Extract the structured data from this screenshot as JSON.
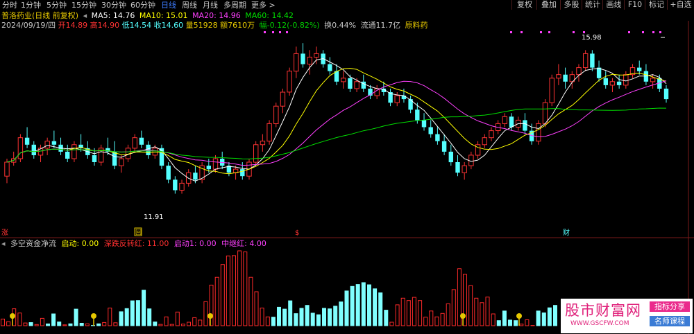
{
  "periods": [
    "分时",
    "1分钟",
    "5分钟",
    "15分钟",
    "30分钟",
    "60分钟",
    "日线",
    "周线",
    "月线",
    "多周期",
    "更多 >"
  ],
  "active_period": "日线",
  "right_buttons": [
    "复权",
    "叠加",
    "多股",
    "统计",
    "画线",
    "F10",
    "标记",
    "+自选"
  ],
  "stock": {
    "title": "普洛药业(日线 前复权)"
  },
  "ma": [
    {
      "label": "MA5: 14.76",
      "color": "#ffffff"
    },
    {
      "label": "MA10: 15.01",
      "color": "#ffff00"
    },
    {
      "label": "MA20: 14.96",
      "color": "#ff40ff"
    },
    {
      "label": "MA60: 14.42",
      "color": "#00e000"
    }
  ],
  "quote": {
    "date": "2024/09/19/四",
    "open": "开14.89",
    "high": "高14.90",
    "low": "低14.54",
    "close": "收14.60",
    "volume": "量51928",
    "amount": "额7610万",
    "change": "幅-0.12(-0.82%)",
    "turnover": "换0.44%",
    "float": "流通11.7亿",
    "concept": "原料药"
  },
  "annotations": {
    "high_label": "15.98",
    "low_label": "11.91"
  },
  "markers": {
    "zhang": "涨",
    "hui": "回",
    "dollar": "$",
    "cai": "财"
  },
  "indicator": {
    "name": "多空资金净流",
    "params": [
      {
        "text": "启动: 0.00",
        "color": "#ffff00"
      },
      {
        "text": "深跌反转红: 11.00",
        "color": "#ff3030"
      },
      {
        "text": "启动1: 0.00",
        "color": "#ff40ff"
      },
      {
        "text": "中继红: 4.00",
        "color": "#ff40ff"
      }
    ]
  },
  "watermark": {
    "title": "股市财富网",
    "url": "WWW.GSCFW.COM",
    "badge1": "指标分享",
    "badge2": "名师课程"
  },
  "colors": {
    "up": "#ff3333",
    "down": "#54ffff",
    "ma5": "#ffffff",
    "ma10": "#ffff00",
    "ma20": "#ff40ff",
    "ma60": "#00e000",
    "grid": "#7a1a1a"
  },
  "chart_data": {
    "type": "candlestick",
    "ylim": [
      11.0,
      16.6
    ],
    "candles": [
      [
        12.4,
        12.9,
        12.2,
        12.8
      ],
      [
        12.8,
        13.1,
        12.7,
        12.9
      ],
      [
        12.9,
        13.6,
        12.8,
        13.5
      ],
      [
        13.5,
        13.8,
        13.2,
        13.3
      ],
      [
        13.3,
        13.4,
        12.9,
        13.0
      ],
      [
        13.0,
        13.3,
        12.8,
        13.2
      ],
      [
        13.2,
        13.5,
        13.0,
        13.4
      ],
      [
        13.4,
        13.7,
        13.2,
        13.3
      ],
      [
        13.3,
        13.5,
        13.0,
        13.1
      ],
      [
        13.1,
        13.3,
        12.8,
        12.9
      ],
      [
        12.9,
        13.4,
        12.8,
        13.3
      ],
      [
        13.3,
        13.6,
        13.1,
        13.2
      ],
      [
        13.2,
        13.4,
        12.9,
        13.0
      ],
      [
        13.0,
        13.2,
        12.7,
        12.8
      ],
      [
        12.8,
        13.3,
        12.7,
        13.2
      ],
      [
        13.2,
        13.5,
        13.0,
        13.1
      ],
      [
        13.1,
        13.4,
        12.6,
        12.7
      ],
      [
        12.7,
        13.0,
        12.5,
        12.9
      ],
      [
        12.9,
        13.3,
        12.8,
        13.2
      ],
      [
        13.2,
        13.6,
        13.1,
        13.5
      ],
      [
        13.5,
        13.7,
        13.2,
        13.3
      ],
      [
        13.3,
        13.4,
        12.9,
        13.0
      ],
      [
        13.0,
        13.3,
        12.9,
        13.2
      ],
      [
        13.2,
        13.3,
        12.6,
        12.7
      ],
      [
        12.7,
        12.8,
        12.2,
        12.3
      ],
      [
        12.3,
        12.4,
        11.9,
        12.0
      ],
      [
        12.0,
        12.3,
        11.9,
        12.2
      ],
      [
        12.2,
        12.6,
        12.1,
        12.5
      ],
      [
        12.5,
        12.7,
        12.2,
        12.3
      ],
      [
        12.3,
        12.8,
        12.2,
        12.7
      ],
      [
        12.7,
        12.9,
        12.5,
        12.6
      ],
      [
        12.6,
        13.0,
        12.5,
        12.9
      ],
      [
        12.9,
        13.1,
        12.6,
        12.7
      ],
      [
        12.7,
        12.8,
        12.4,
        12.5
      ],
      [
        12.5,
        12.7,
        12.3,
        12.6
      ],
      [
        12.6,
        12.8,
        12.3,
        12.4
      ],
      [
        12.4,
        12.9,
        12.3,
        12.8
      ],
      [
        12.8,
        13.4,
        12.7,
        13.3
      ],
      [
        13.3,
        13.6,
        13.1,
        13.4
      ],
      [
        13.4,
        14.0,
        13.3,
        13.9
      ],
      [
        13.9,
        14.5,
        13.8,
        14.4
      ],
      [
        14.4,
        14.9,
        14.2,
        14.8
      ],
      [
        14.8,
        15.5,
        14.7,
        15.4
      ],
      [
        15.4,
        16.1,
        15.2,
        15.9
      ],
      [
        15.9,
        16.2,
        15.5,
        15.6
      ],
      [
        15.6,
        16.0,
        15.3,
        15.8
      ],
      [
        15.8,
        16.1,
        15.6,
        15.9
      ],
      [
        15.9,
        16.0,
        15.5,
        15.6
      ],
      [
        15.6,
        15.8,
        15.3,
        15.4
      ],
      [
        15.4,
        15.6,
        15.0,
        15.1
      ],
      [
        15.1,
        15.4,
        14.9,
        15.2
      ],
      [
        15.2,
        15.3,
        14.8,
        14.9
      ],
      [
        14.9,
        15.2,
        14.8,
        15.1
      ],
      [
        15.1,
        15.3,
        14.8,
        14.9
      ],
      [
        14.9,
        15.0,
        14.6,
        14.7
      ],
      [
        14.7,
        15.0,
        14.6,
        14.9
      ],
      [
        14.9,
        15.1,
        14.7,
        14.8
      ],
      [
        14.8,
        14.9,
        14.4,
        14.5
      ],
      [
        14.5,
        14.8,
        14.4,
        14.7
      ],
      [
        14.7,
        14.9,
        14.5,
        14.6
      ],
      [
        14.6,
        14.7,
        14.2,
        14.3
      ],
      [
        14.3,
        14.5,
        13.9,
        14.0
      ],
      [
        14.0,
        14.2,
        13.7,
        13.8
      ],
      [
        13.8,
        14.0,
        13.5,
        13.6
      ],
      [
        13.6,
        13.8,
        13.3,
        13.4
      ],
      [
        13.4,
        13.6,
        13.0,
        13.1
      ],
      [
        13.1,
        13.3,
        12.7,
        12.8
      ],
      [
        12.8,
        13.0,
        12.4,
        12.5
      ],
      [
        12.5,
        12.8,
        12.3,
        12.7
      ],
      [
        12.7,
        13.1,
        12.6,
        13.0
      ],
      [
        13.0,
        13.4,
        12.9,
        13.3
      ],
      [
        13.3,
        13.6,
        13.2,
        13.5
      ],
      [
        13.5,
        13.8,
        13.4,
        13.7
      ],
      [
        13.7,
        14.0,
        13.6,
        13.9
      ],
      [
        13.9,
        14.2,
        13.8,
        14.1
      ],
      [
        14.1,
        14.2,
        13.7,
        13.8
      ],
      [
        13.8,
        14.1,
        13.7,
        14.0
      ],
      [
        14.0,
        14.2,
        13.6,
        13.7
      ],
      [
        13.7,
        13.9,
        13.3,
        13.4
      ],
      [
        13.4,
        14.0,
        13.3,
        13.9
      ],
      [
        13.9,
        14.6,
        13.8,
        14.5
      ],
      [
        14.5,
        15.3,
        14.4,
        15.2
      ],
      [
        15.2,
        15.6,
        15.0,
        15.3
      ],
      [
        15.3,
        15.5,
        14.9,
        15.1
      ],
      [
        15.1,
        15.4,
        14.9,
        15.3
      ],
      [
        15.3,
        15.6,
        15.1,
        15.5
      ],
      [
        15.5,
        16.0,
        15.4,
        15.9
      ],
      [
        15.9,
        16.0,
        15.4,
        15.5
      ],
      [
        15.5,
        15.7,
        15.1,
        15.2
      ],
      [
        15.2,
        15.4,
        14.9,
        15.0
      ],
      [
        15.0,
        15.2,
        14.8,
        15.1
      ],
      [
        15.1,
        15.3,
        14.9,
        15.0
      ],
      [
        15.0,
        15.4,
        14.9,
        15.3
      ],
      [
        15.3,
        15.6,
        15.2,
        15.5
      ],
      [
        15.5,
        15.7,
        15.3,
        15.4
      ],
      [
        15.4,
        15.6,
        15.0,
        15.1
      ],
      [
        15.1,
        15.3,
        14.9,
        15.2
      ],
      [
        15.2,
        15.3,
        14.8,
        14.9
      ],
      [
        14.9,
        15.0,
        14.5,
        14.6
      ]
    ]
  }
}
